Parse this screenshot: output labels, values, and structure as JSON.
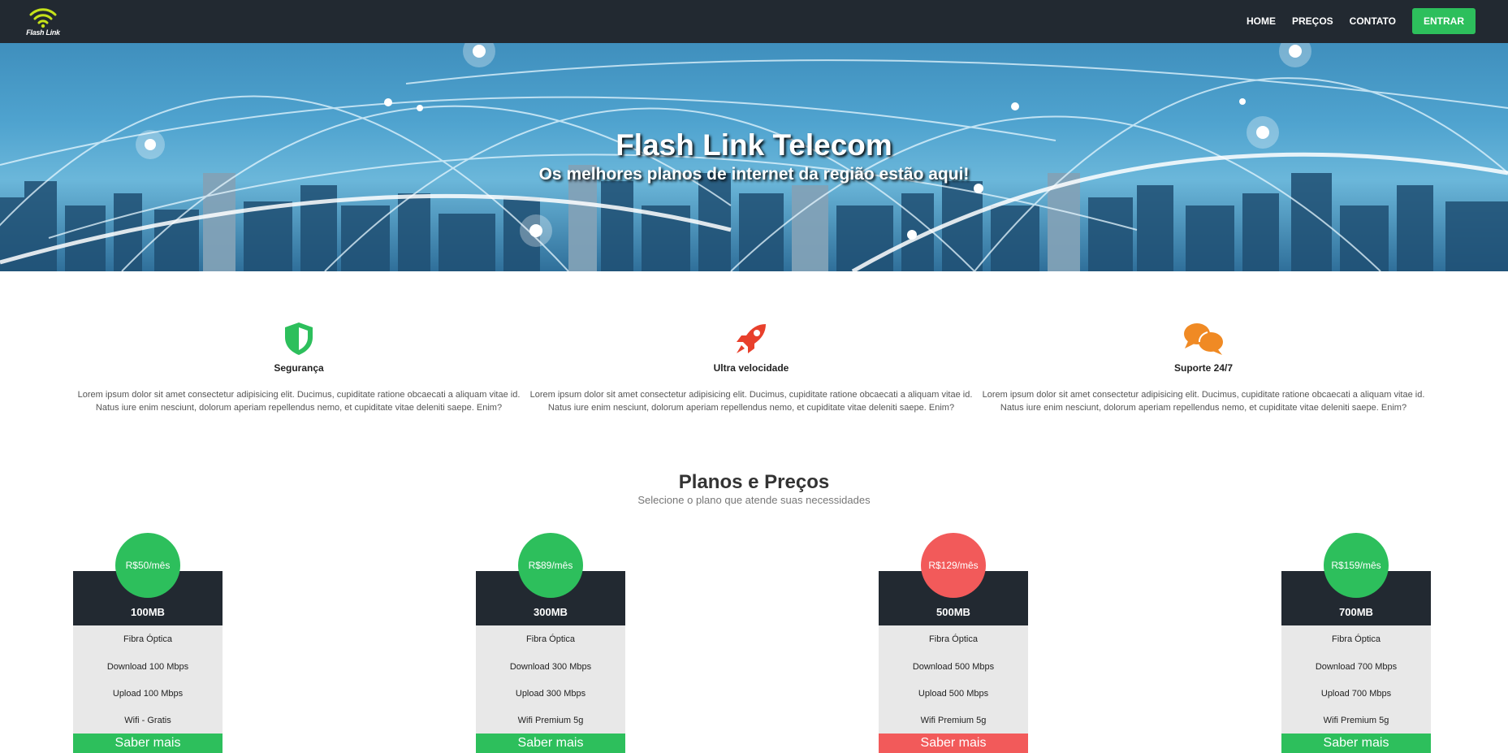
{
  "navbar": {
    "logo_text": "Flash Link",
    "links": [
      {
        "label": "HOME"
      },
      {
        "label": "PREÇOS"
      },
      {
        "label": "CONTATO"
      }
    ],
    "cta_label": "ENTRAR",
    "cta_color": "#2dbf5c",
    "background": "#222931"
  },
  "hero": {
    "title": "Flash Link Telecom",
    "subtitle": "Os melhores planos de internet da região estão aqui!"
  },
  "features": [
    {
      "icon": "shield-icon",
      "title": "Segurança",
      "text_line1": "Lorem ipsum dolor sit amet consectetur adipisicing elit. Ducimus, cupiditate ratione obcaecati a aliquam vitae id.",
      "text_line2": "Natus iure enim nesciunt, dolorum aperiam repellendus nemo, et cupiditate vitae deleniti saepe. Enim?",
      "color": "#2dbf5c"
    },
    {
      "icon": "rocket-icon",
      "title": "Ultra velocidade",
      "text_line1": "Lorem ipsum dolor sit amet consectetur adipisicing elit. Ducimus, cupiditate ratione obcaecati a aliquam vitae id.",
      "text_line2": "Natus iure enim nesciunt, dolorum aperiam repellendus nemo, et cupiditate vitae deleniti saepe. Enim?",
      "color": "#e8402c"
    },
    {
      "icon": "chat-bubbles-icon",
      "title": "Suporte 24/7",
      "text_line1": "Lorem ipsum dolor sit amet consectetur adipisicing elit. Ducimus, cupiditate ratione obcaecati a aliquam vitae id.",
      "text_line2": "Natus iure enim nesciunt, dolorum aperiam repellendus nemo, et cupiditate vitae deleniti saepe. Enim?",
      "color": "#f08a24"
    }
  ],
  "plans_section": {
    "title": "Planos e Preços",
    "subtitle": "Selecione o plano que atende suas necessidades"
  },
  "plans": [
    {
      "price": "R$50/mês",
      "name": "100MB",
      "items": [
        "Fibra Óptica",
        "Download 100 Mbps",
        "Upload 100 Mbps",
        "Wifi - Gratis"
      ],
      "button": "Saber mais",
      "accent": "#2dbf5c"
    },
    {
      "price": "R$89/mês",
      "name": "300MB",
      "items": [
        "Fibra Óptica",
        "Download 300 Mbps",
        "Upload 300 Mbps",
        "Wifi Premium 5g"
      ],
      "button": "Saber mais",
      "accent": "#2dbf5c"
    },
    {
      "price": "R$129/mês",
      "name": "500MB",
      "items": [
        "Fibra Óptica",
        "Download 500 Mbps",
        "Upload 500 Mbps",
        "Wifi Premium 5g"
      ],
      "button": "Saber mais",
      "accent": "#f25a5a"
    },
    {
      "price": "R$159/mês",
      "name": "700MB",
      "items": [
        "Fibra Óptica",
        "Download 700 Mbps",
        "Upload 700 Mbps",
        "Wifi Premium 5g"
      ],
      "button": "Saber mais",
      "accent": "#2dbf5c"
    }
  ]
}
